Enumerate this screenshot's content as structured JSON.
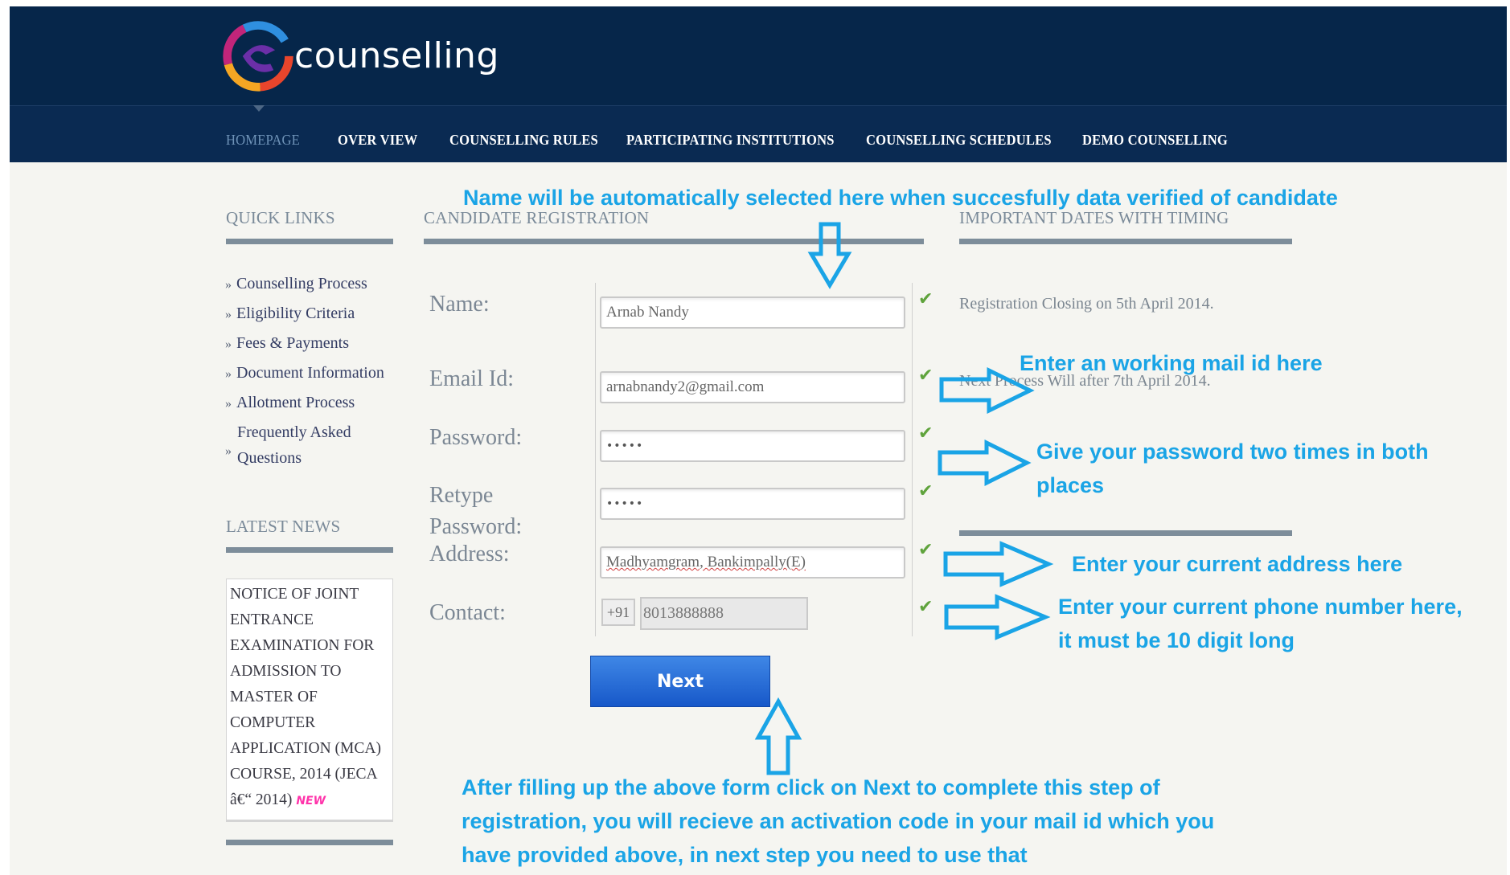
{
  "brand": {
    "logo_text": "counselling"
  },
  "nav": {
    "items": [
      {
        "label": "HOMEPAGE",
        "active": true
      },
      {
        "label": "OVER VIEW"
      },
      {
        "label": "COUNSELLING RULES"
      },
      {
        "label": "PARTICIPATING INSTITUTIONS"
      },
      {
        "label": "COUNSELLING SCHEDULES"
      },
      {
        "label": "DEMO COUNSELLING"
      }
    ]
  },
  "sidebar": {
    "quick_links_title": "QUICK LINKS",
    "quick_links": [
      "Counselling Process",
      "Eligibility Criteria",
      "Fees & Payments",
      "Document Information",
      "Allotment Process",
      "Frequently Asked",
      "Questions"
    ],
    "latest_news_title": "LATEST NEWS",
    "news_text": "NOTICE OF JOINT ENTRANCE EXAMINATION FOR ADMISSION TO MASTER OF COMPUTER APPLICATION (MCA) COURSE, 2014 (JECA â€“ 2014)",
    "news_badge": "NEW"
  },
  "form": {
    "title": "CANDIDATE REGISTRATION",
    "name_label": "Name:",
    "name_value": "Arnab Nandy",
    "email_label": "Email Id:",
    "email_value": "arnabnandy2@gmail.com",
    "password_label": "Password:",
    "password_value": "•••••",
    "retype_label_1": "Retype",
    "retype_label_2": "Password:",
    "retype_value": "•••••",
    "address_label": "Address:",
    "address_value": "Madhyamgram, Bankimpally(E)",
    "contact_label": "Contact:",
    "contact_prefix": "+91",
    "contact_value": "8013888888",
    "next_label": "Next"
  },
  "dates": {
    "title": "IMPORTANT DATES WITH TIMING",
    "line1": "Registration Closing on 5th April 2014.",
    "line2": "Next Process Will after 7th April 2014."
  },
  "annotations": {
    "top": "Name will be automatically selected here when succesfully data verified of candidate",
    "email": "Enter an working mail id here",
    "password_1": "Give your password two times in both",
    "password_2": "places",
    "address": "Enter your current address here",
    "contact_1": "Enter your current phone number here,",
    "contact_2": "it must be 10 digit long",
    "bottom_1": "After filling up the above form click on Next to complete this step of",
    "bottom_2": "registration, you will recieve an activation code in your mail id which you",
    "bottom_3": "have provided above, in next step you need to use that"
  },
  "colors": {
    "header_bg": "#06264a",
    "nav_active": "#6f93b8",
    "annotation": "#1aa4e6",
    "check": "#5fa33c",
    "button": "#2a6fda"
  }
}
